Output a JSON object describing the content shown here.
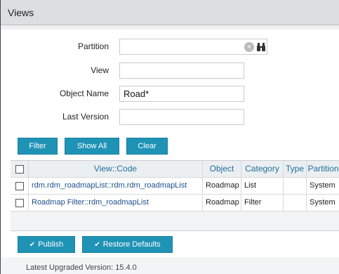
{
  "window": {
    "title": "Views"
  },
  "form": {
    "partition": {
      "label": "Partition",
      "value": ""
    },
    "view": {
      "label": "View",
      "value": ""
    },
    "object_name": {
      "label": "Object Name",
      "value": "Road*"
    },
    "last_version": {
      "label": "Last Version",
      "value": ""
    }
  },
  "toolbar": {
    "filter": "Filter",
    "show_all": "Show All",
    "clear": "Clear"
  },
  "grid": {
    "columns": [
      "View::Code",
      "Object",
      "Category",
      "Type",
      "Partition"
    ],
    "rows": [
      {
        "code": "rdm.rdm_roadmapList::rdm.rdm_roadmapList",
        "object": "Roadmap",
        "category": "List",
        "type": "",
        "partition": "System"
      },
      {
        "code": "Roadmap Filter::rdm_roadmapList",
        "object": "Roadmap",
        "category": "Filter",
        "type": "",
        "partition": "System"
      }
    ]
  },
  "footer": {
    "publish": "Publish",
    "restore_defaults": "Restore Defaults",
    "version": "Latest Upgraded Version: 15.4.0"
  },
  "colors": {
    "button": "#1f93b5",
    "header_text": "#1f6fa0",
    "link": "#1d4f8c"
  }
}
